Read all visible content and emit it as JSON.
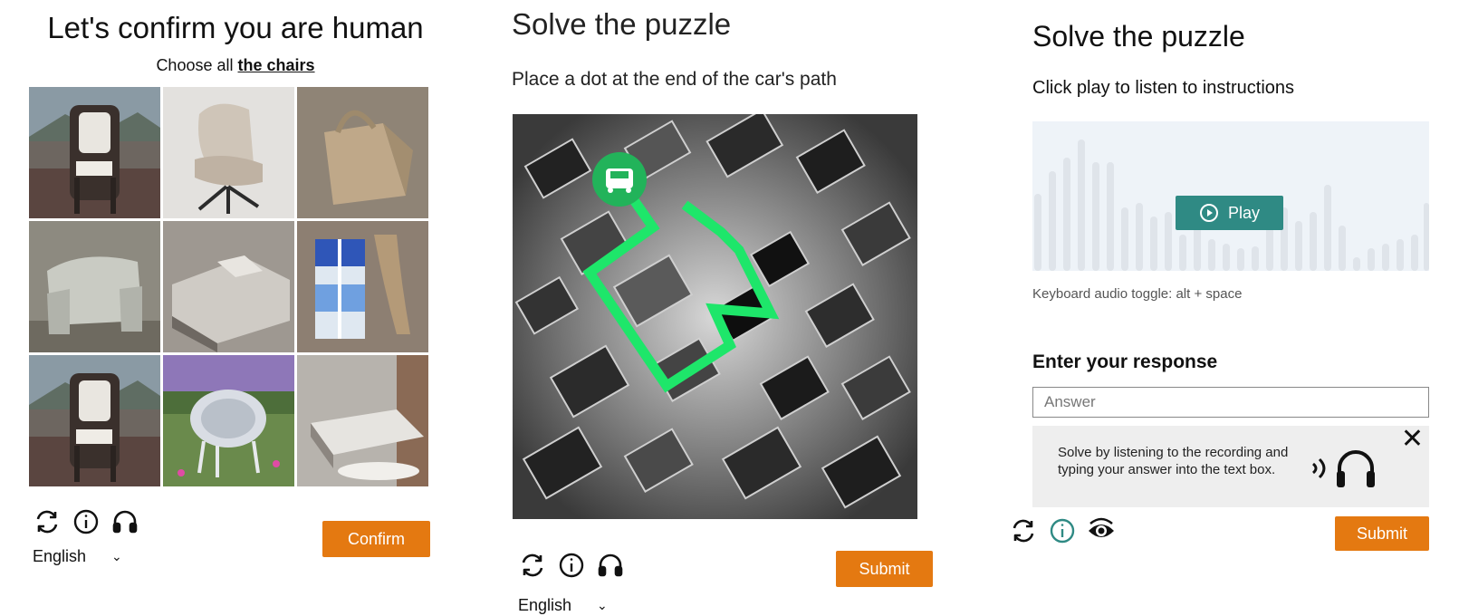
{
  "image_captcha": {
    "title": "Let's confirm you are human",
    "instruction_prefix": "Choose all",
    "instruction_target": "the chairs",
    "tiles": [
      "chair",
      "armchair",
      "bag",
      "armchair",
      "bed",
      "window curtain",
      "chair",
      "chair",
      "bed"
    ],
    "icons": [
      "refresh-icon",
      "info-icon",
      "headphones-icon"
    ],
    "language": "English",
    "confirm_label": "Confirm"
  },
  "car_puzzle": {
    "title": "Solve the puzzle",
    "instruction": "Place a dot at the end of the car's path",
    "icons": [
      "refresh-icon",
      "info-icon",
      "headphones-icon"
    ],
    "language": "English",
    "submit_label": "Submit"
  },
  "audio_puzzle": {
    "title": "Solve the puzzle",
    "instruction": "Click play to listen to instructions",
    "play_label": "Play",
    "keyboard_hint": "Keyboard audio toggle: alt + space",
    "response_label": "Enter your response",
    "answer_placeholder": "Answer",
    "tip_text": "Solve by listening to the recording and typing your answer into the text box.",
    "icons": [
      "refresh-icon",
      "info-icon",
      "eye-icon"
    ],
    "submit_label": "Submit"
  },
  "colors": {
    "orange": "#e47911",
    "teal": "#2f8a84",
    "path_green": "#1ee66a"
  }
}
